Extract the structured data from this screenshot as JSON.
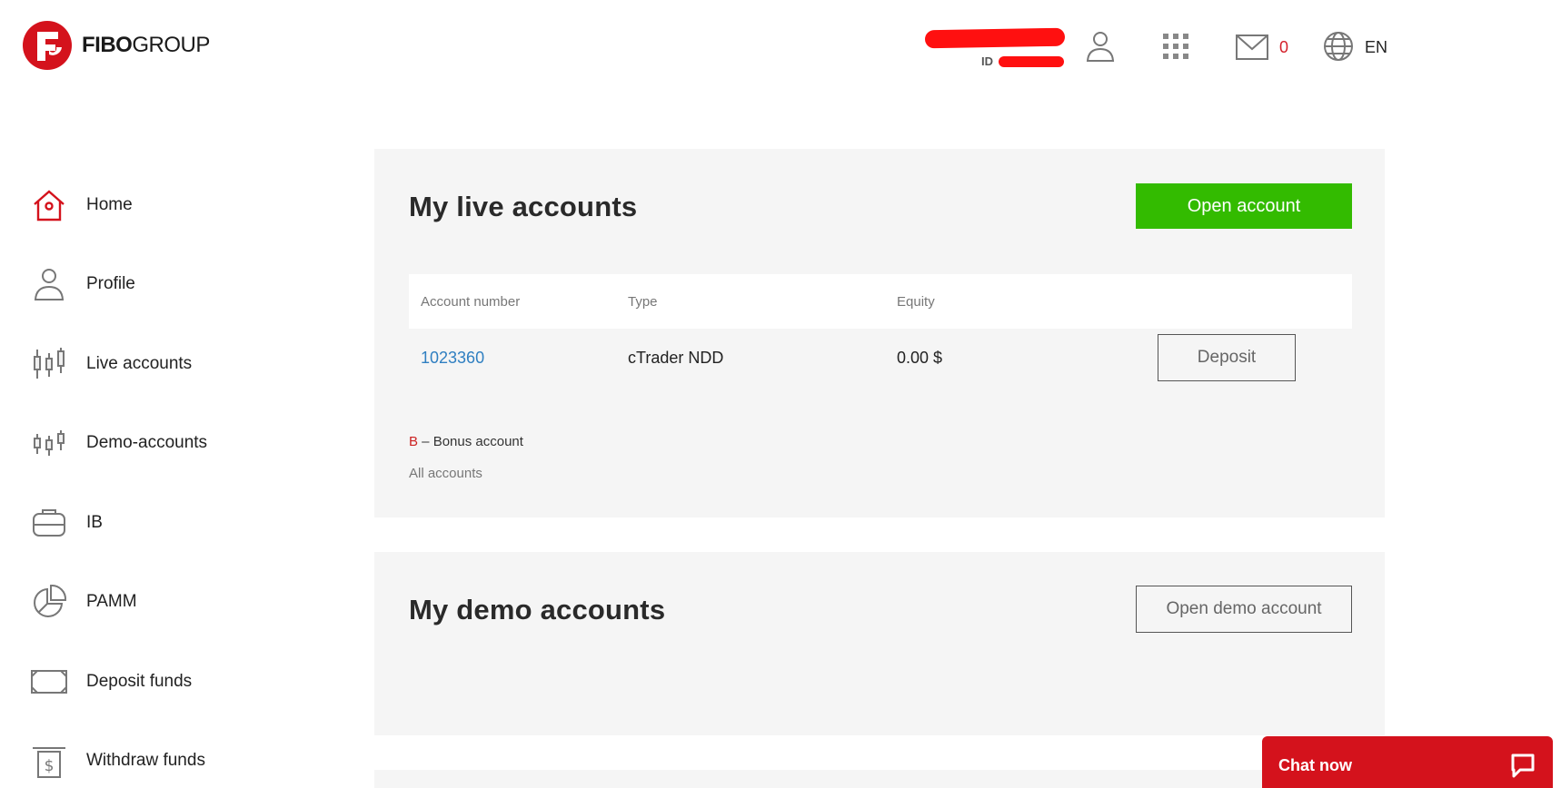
{
  "brand": {
    "name_bold": "FIBO",
    "name_rest": "GROUP",
    "color": "#d4121c"
  },
  "header": {
    "id_label": "ID",
    "mail_count": "0",
    "language": "EN",
    "icons": [
      "user-icon",
      "apps-grid-icon",
      "mail-icon",
      "globe-icon"
    ]
  },
  "sidebar": {
    "items": [
      {
        "label": "Home",
        "icon": "home-icon",
        "active": true
      },
      {
        "label": "Profile",
        "icon": "profile-icon"
      },
      {
        "label": "Live accounts",
        "icon": "candlestick-icon"
      },
      {
        "label": "Demo-accounts",
        "icon": "candlestick-small-icon"
      },
      {
        "label": "IB",
        "icon": "briefcase-icon"
      },
      {
        "label": "PAMM",
        "icon": "pie-chart-icon"
      },
      {
        "label": "Deposit funds",
        "icon": "frame-icon"
      },
      {
        "label": "Withdraw funds",
        "icon": "withdraw-dollar-icon"
      }
    ]
  },
  "live": {
    "title": "My live accounts",
    "open_button": "Open account",
    "columns": [
      "Account number",
      "Type",
      "Equity"
    ],
    "rows": [
      {
        "number": "1023360",
        "type": "cTrader NDD",
        "equity": "0.00 $",
        "action": "Deposit"
      }
    ],
    "legend_letter": "B",
    "legend_text": " – Bonus account",
    "all_accounts": "All accounts"
  },
  "demo": {
    "title": "My demo accounts",
    "open_button": "Open demo account"
  },
  "chat": {
    "label": "Chat now"
  },
  "colors": {
    "accent_red": "#d4121c",
    "green": "#33bb00",
    "link": "#2f7fc1",
    "panel_bg": "#f5f5f5"
  }
}
